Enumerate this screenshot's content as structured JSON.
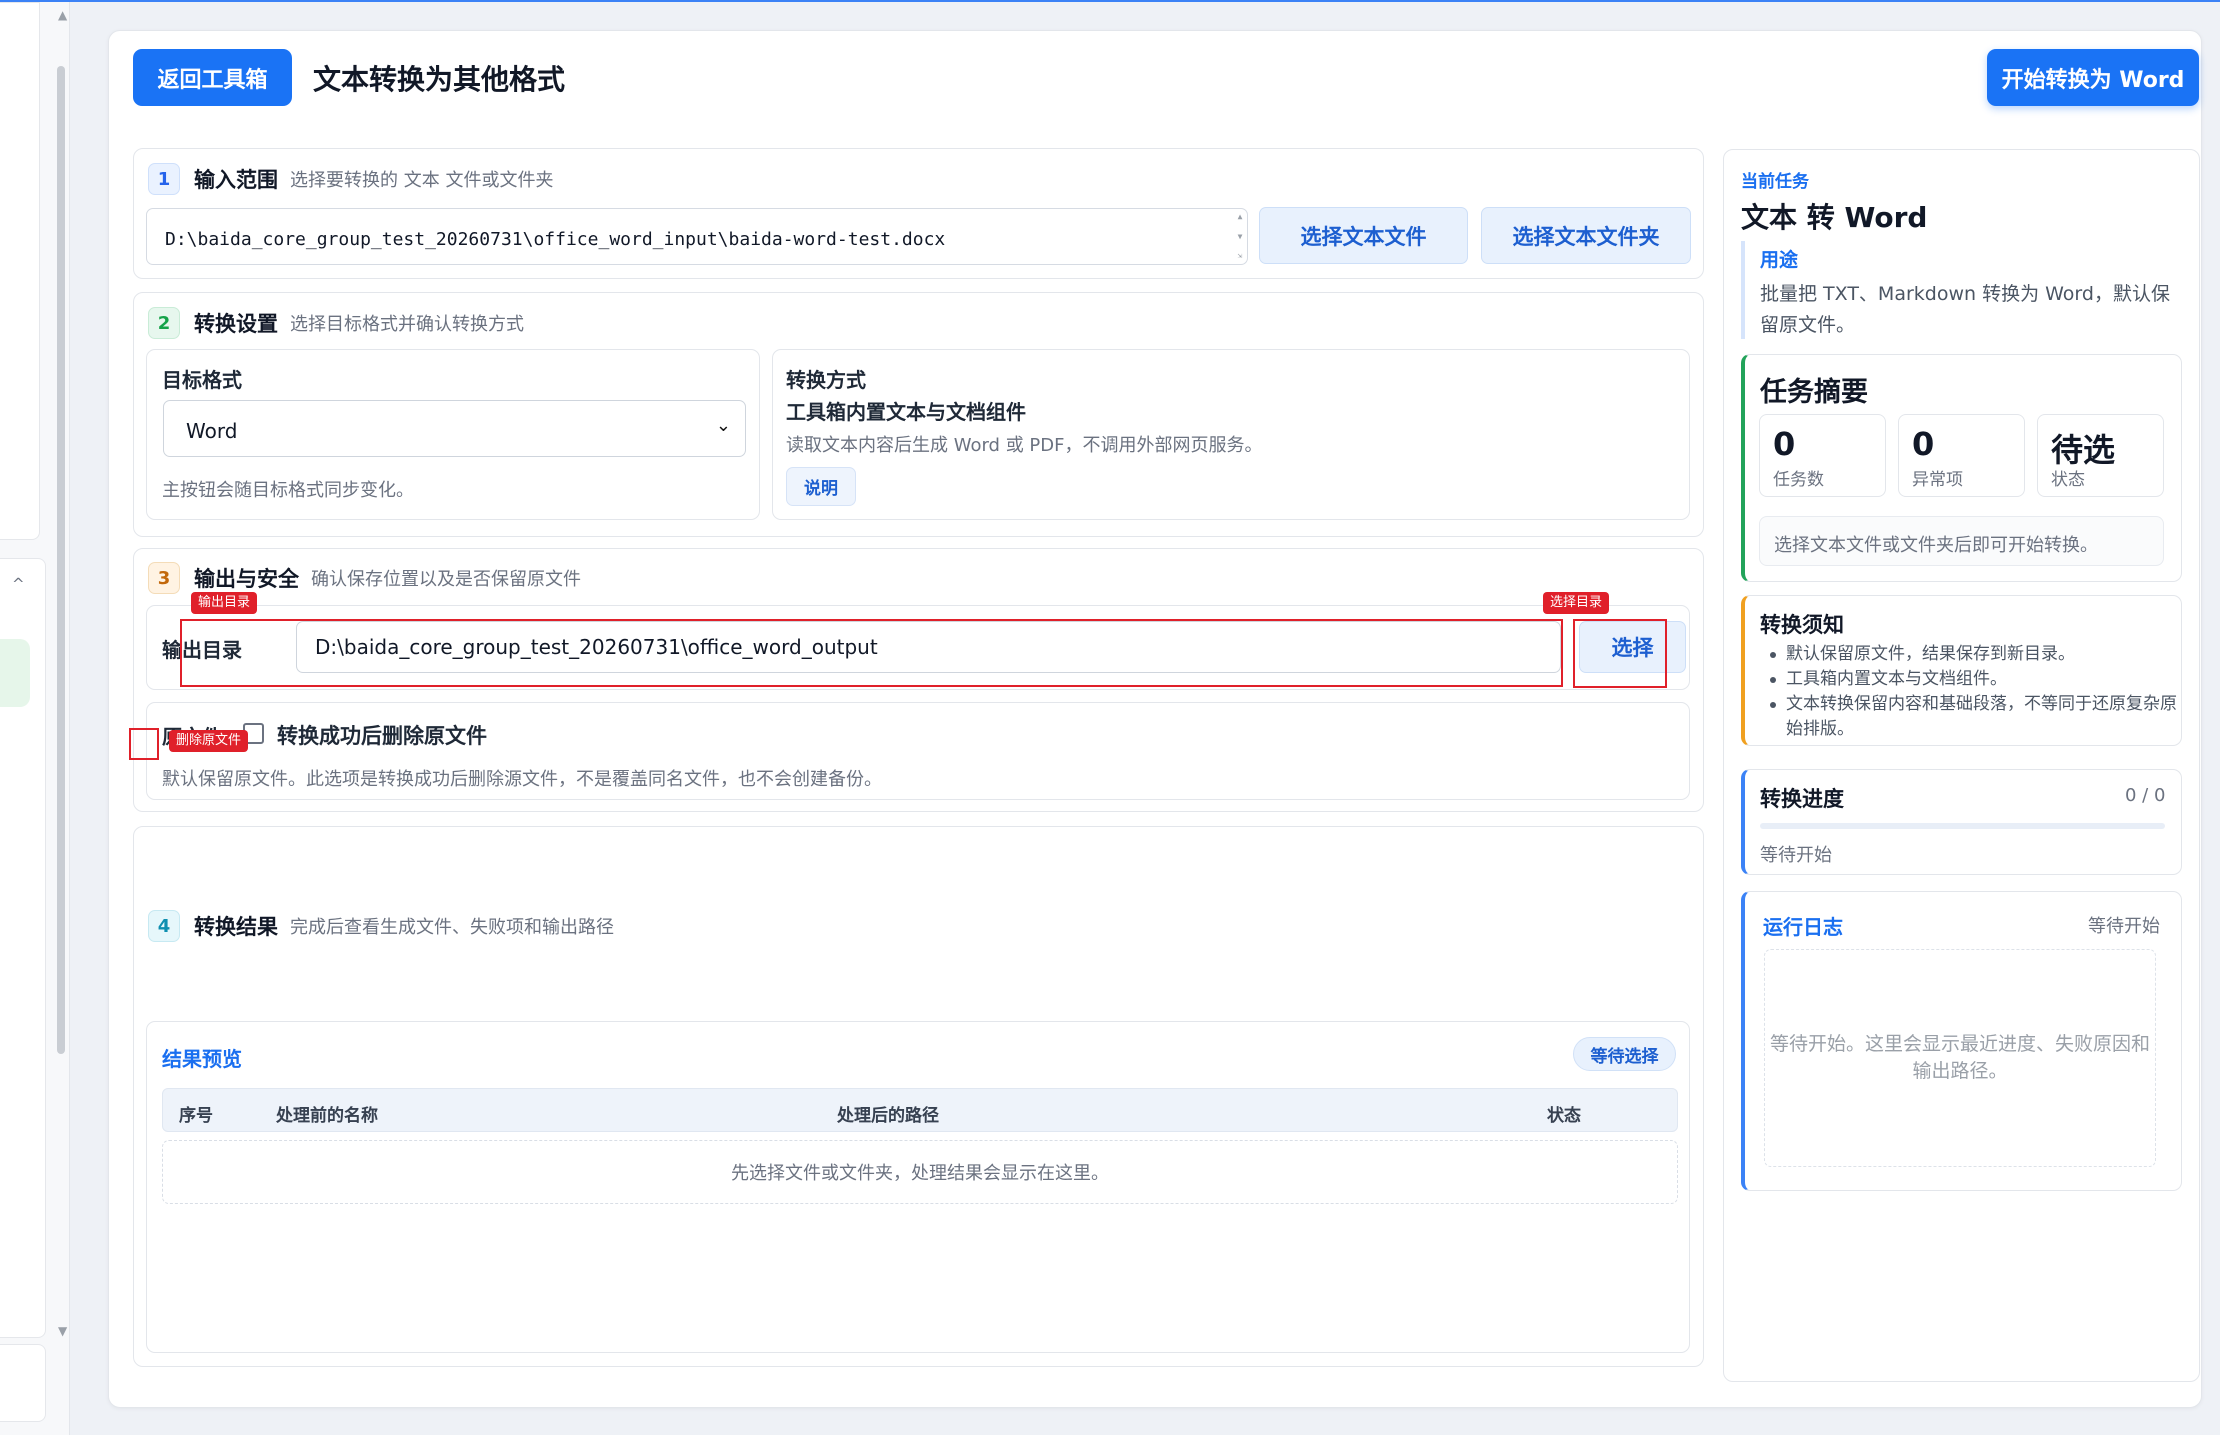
{
  "app": {
    "back_button": "返回工具箱",
    "title": "文本转换为其他格式",
    "start_button": "开始转换为 Word"
  },
  "step1": {
    "num": "1",
    "title": "输入范围",
    "desc": "选择要转换的 文本 文件或文件夹",
    "input_path": "D:\\baida_core_group_test_20260731\\office_word_input\\baida-word-test.docx",
    "btn_file": "选择文本文件",
    "btn_folder": "选择文本文件夹"
  },
  "step2": {
    "num": "2",
    "title": "转换设置",
    "desc": "选择目标格式并确认转换方式",
    "target_label": "目标格式",
    "target_value": "Word",
    "target_hint": "主按钮会随目标格式同步变化。",
    "method_label": "转换方式",
    "method_name": "工具箱内置文本与文档组件",
    "method_desc": "读取文本内容后生成 Word 或 PDF，不调用外部网页服务。",
    "method_button": "说明"
  },
  "step3": {
    "num": "3",
    "title": "输出与安全",
    "desc": "确认保存位置以及是否保留原文件",
    "output_label": "输出目录",
    "output_path": "D:\\baida_core_group_test_20260731\\office_word_output",
    "choose_button": "选择",
    "tag_output_dir": "输出目录",
    "tag_choose_dir": "选择目录",
    "original_label": "原文件",
    "delete_label": "转换成功后删除原文件",
    "tag_delete": "删除原文件",
    "delete_hint": "默认保留原文件。此选项是转换成功后删除源文件，不是覆盖同名文件，也不会创建备份。"
  },
  "step4": {
    "num": "4",
    "title": "转换结果",
    "desc": "完成后查看生成文件、失败项和输出路径",
    "preview_title": "结果预览",
    "preview_status": "等待选择",
    "columns": [
      "序号",
      "处理前的名称",
      "处理后的路径",
      "状态"
    ],
    "empty_text": "先选择文件或文件夹，处理结果会显示在这里。"
  },
  "sidebar": {
    "current_label": "当前任务",
    "task_title": "文本 转 Word",
    "usage_label": "用途",
    "usage_text": "批量把 TXT、Markdown 转换为 Word，默认保留原文件。",
    "summary_title": "任务摘要",
    "stats": [
      {
        "value": "0",
        "label": "任务数"
      },
      {
        "value": "0",
        "label": "异常项"
      },
      {
        "value": "待选",
        "label": "状态"
      }
    ],
    "summary_hint": "选择文本文件或文件夹后即可开始转换。",
    "notes_title": "转换须知",
    "notes": [
      "默认保留原文件，结果保存到新目录。",
      "工具箱内置文本与文档组件。",
      "文本转换保留内容和基础段落，不等同于还原复杂原始排版。"
    ],
    "progress_title": "转换进度",
    "progress_count": "0 / 0",
    "progress_value": 0,
    "progress_status": "等待开始",
    "log_title": "运行日志",
    "log_status": "等待开始",
    "log_text": "等待开始。这里会显示最近进度、失败原因和输出路径。"
  },
  "colors": {
    "primary": "#1a73f5",
    "accent_green": "#22a35a",
    "accent_orange": "#f0a020",
    "accent_blue": "#3b82f6",
    "annotation_red": "#e0202a"
  },
  "icons": {
    "select_chevron": "chevron-down-icon",
    "checkbox": "checkbox-icon"
  }
}
